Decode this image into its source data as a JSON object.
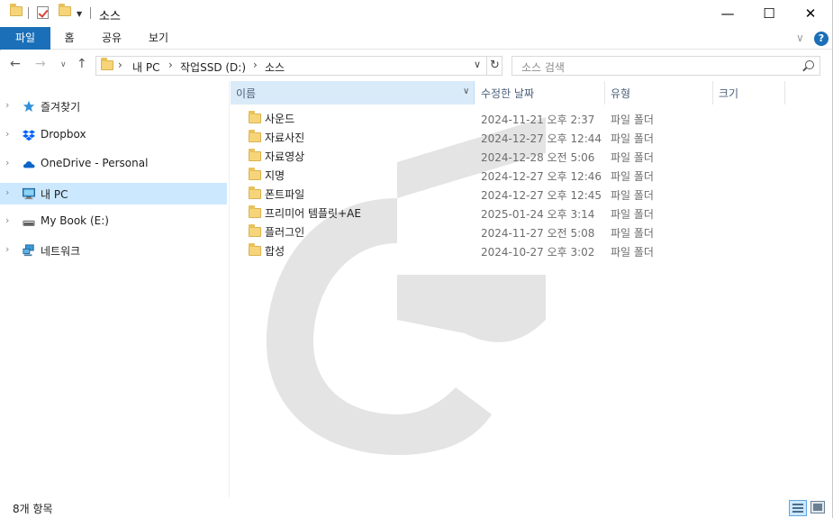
{
  "window": {
    "title": "소스",
    "minimize": "—",
    "maximize": "☐",
    "close": "✕"
  },
  "ribbon": {
    "tabs": [
      {
        "label": "파일"
      },
      {
        "label": "홈"
      },
      {
        "label": "공유"
      },
      {
        "label": "보기"
      }
    ],
    "help": "?"
  },
  "address": {
    "crumbs": [
      "내 PC",
      "작업SSD (D:)",
      "소스"
    ]
  },
  "search": {
    "placeholder": "소스 검색"
  },
  "nav": {
    "items": [
      {
        "label": "즐겨찾기",
        "icon": "star-icon"
      },
      {
        "label": "Dropbox",
        "icon": "dropbox-icon"
      },
      {
        "label": "OneDrive - Personal",
        "icon": "cloud-icon"
      },
      {
        "label": "내 PC",
        "icon": "computer-icon",
        "selected": true
      },
      {
        "label": "My Book (E:)",
        "icon": "drive-icon"
      },
      {
        "label": "네트워크",
        "icon": "network-icon"
      }
    ]
  },
  "columns": {
    "name": "이름",
    "date": "수정한 날짜",
    "type": "유형",
    "size": "크기"
  },
  "files": [
    {
      "name": "사운드",
      "date": "2024-11-21 오후 2:37",
      "type": "파일 폴더"
    },
    {
      "name": "자료사진",
      "date": "2024-12-27 오후 12:44",
      "type": "파일 폴더"
    },
    {
      "name": "자료영상",
      "date": "2024-12-28 오전 5:06",
      "type": "파일 폴더"
    },
    {
      "name": "지명",
      "date": "2024-12-27 오후 12:46",
      "type": "파일 폴더"
    },
    {
      "name": "폰트파일",
      "date": "2024-12-27 오후 12:45",
      "type": "파일 폴더"
    },
    {
      "name": "프리미어 템플릿+AE",
      "date": "2025-01-24 오후 3:14",
      "type": "파일 폴더"
    },
    {
      "name": "플러그인",
      "date": "2024-11-27 오전 5:08",
      "type": "파일 폴더"
    },
    {
      "name": "합성",
      "date": "2024-10-27 오후 3:02",
      "type": "파일 폴더"
    }
  ],
  "status": {
    "count": "8개 항목"
  },
  "colors": {
    "accent": "#1a6fb8",
    "selection": "#cce8ff",
    "folder": "#f6d57a"
  }
}
